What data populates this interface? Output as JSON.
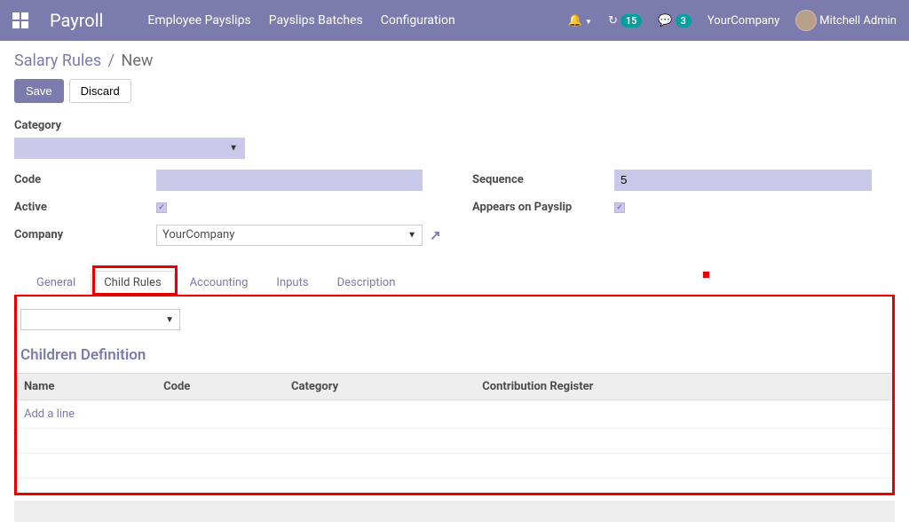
{
  "navbar": {
    "brand": "Payroll",
    "links": [
      "Employee Payslips",
      "Payslips Batches",
      "Configuration"
    ],
    "clock_badge": "15",
    "chat_badge": "3",
    "company": "YourCompany",
    "user": "Mitchell Admin"
  },
  "breadcrumb": {
    "parent": "Salary Rules",
    "current": "New"
  },
  "buttons": {
    "save": "Save",
    "discard": "Discard"
  },
  "form": {
    "category_label": "Category",
    "category_value": "",
    "code_label": "Code",
    "code_value": "",
    "sequence_label": "Sequence",
    "sequence_value": "5",
    "active_label": "Active",
    "active_value": true,
    "appears_label": "Appears on Payslip",
    "appears_value": true,
    "company_label": "Company",
    "company_value": "YourCompany"
  },
  "tabs": [
    "General",
    "Child Rules",
    "Accounting",
    "Inputs",
    "Description"
  ],
  "active_tab": "Child Rules",
  "child_rules": {
    "section_title": "Children Definition",
    "columns": [
      "Name",
      "Code",
      "Category",
      "Contribution Register"
    ],
    "add_line": "Add a line"
  }
}
